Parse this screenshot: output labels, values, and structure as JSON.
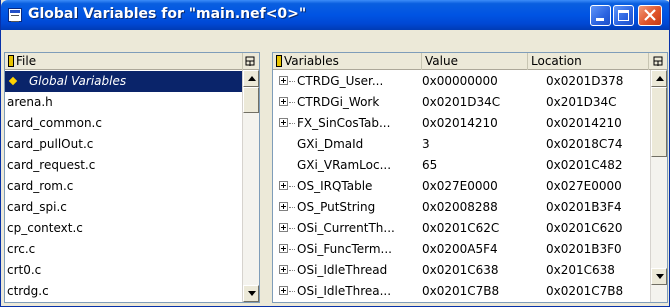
{
  "window": {
    "title": "Global Variables for \"main.nef<0>\"",
    "accent": "#0054e3",
    "selection_color": "#0a246a"
  },
  "files_pane": {
    "header": "File",
    "header_icon": "sort-icon",
    "items": [
      {
        "label": "Global Variables",
        "selected": true
      },
      {
        "label": "arena.h"
      },
      {
        "label": "card_common.c"
      },
      {
        "label": "card_pullOut.c"
      },
      {
        "label": "card_request.c"
      },
      {
        "label": "card_rom.c"
      },
      {
        "label": "card_spi.c"
      },
      {
        "label": "cp_context.c"
      },
      {
        "label": "crc.c"
      },
      {
        "label": "crt0.c"
      },
      {
        "label": "ctrdg.c"
      }
    ]
  },
  "variables_pane": {
    "columns": [
      "Variables",
      "Value",
      "Location"
    ],
    "rows": [
      {
        "name": "CTRDG_User...",
        "value": "0x00000000",
        "location": "0x0201D378",
        "expandable": true
      },
      {
        "name": "CTRDGi_Work",
        "value": "0x0201D34C",
        "location": "0x201D34C",
        "expandable": true
      },
      {
        "name": "FX_SinCosTab...",
        "value": "0x02014210",
        "location": "0x02014210",
        "expandable": true
      },
      {
        "name": "GXi_DmaId",
        "value": "3",
        "location": "0x02018C74",
        "expandable": false
      },
      {
        "name": "GXi_VRamLoc...",
        "value": "65",
        "location": "0x0201C482",
        "expandable": false
      },
      {
        "name": "OS_IRQTable",
        "value": "0x027E0000",
        "location": "0x027E0000",
        "expandable": true
      },
      {
        "name": "OS_PutString",
        "value": "0x02008288",
        "location": "0x0201B3F4",
        "expandable": true
      },
      {
        "name": "OSi_CurrentTh...",
        "value": "0x0201C62C",
        "location": "0x0201C620",
        "expandable": true
      },
      {
        "name": "OSi_FuncTerm...",
        "value": "0x0200A5F4",
        "location": "0x0201B3F0",
        "expandable": true
      },
      {
        "name": "OSi_IdleThread",
        "value": "0x0201C638",
        "location": "0x201C638",
        "expandable": true
      },
      {
        "name": "OSi_IdleThrea...",
        "value": "0x0201C7B8",
        "location": "0x0201C7B8",
        "expandable": true
      }
    ]
  }
}
